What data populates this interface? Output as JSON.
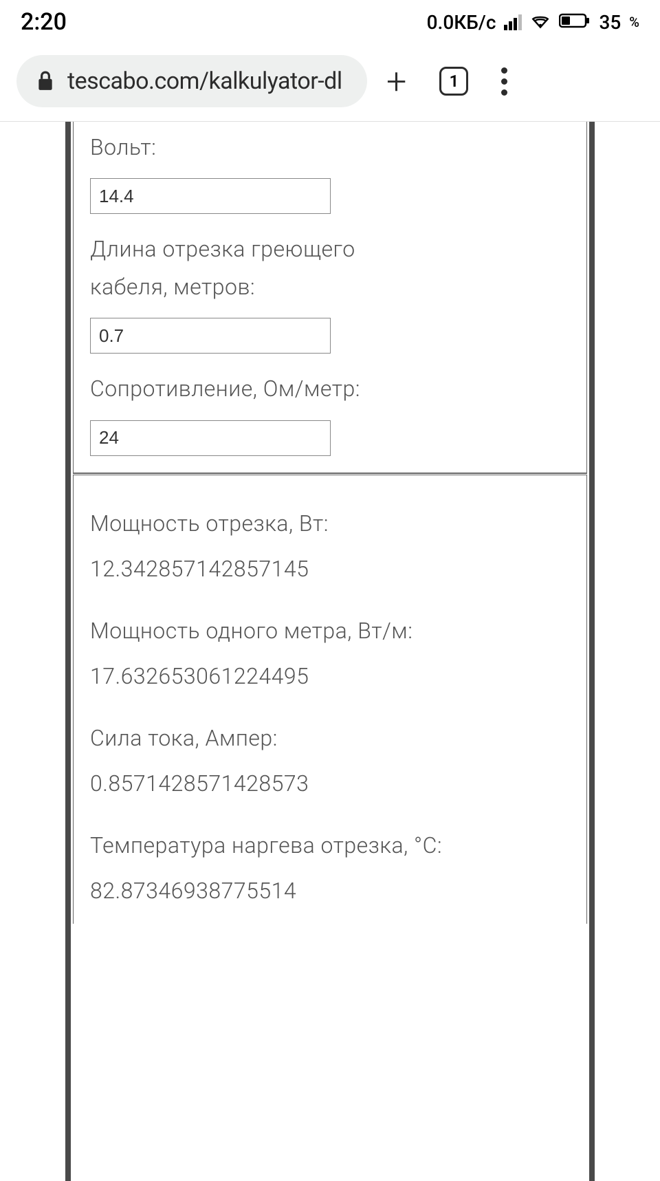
{
  "status": {
    "time": "2:20",
    "net_speed": "0.0КБ/с",
    "battery_pct": "35",
    "pct_sign": "%"
  },
  "browser": {
    "url": "tescabo.com/kalkulyator-dl",
    "tab_count": "1"
  },
  "calculator": {
    "inputs": {
      "voltage_label": "Вольт:",
      "voltage_value": "14.4",
      "length_label": "Длина отрезка греющего кабеля, метров:",
      "length_value": "0.7",
      "resistance_label": "Сопротивление, Ом/метр:",
      "resistance_value": "24"
    },
    "results": {
      "power_label": "Мощность отрезка, Вт:",
      "power_value": "12.342857142857145",
      "power_per_m_label": "Мощность одного метра, Вт/м:",
      "power_per_m_value": "17.632653061224495",
      "current_label": "Сила тока, Ампер:",
      "current_value": "0.8571428571428573",
      "temp_label": "Температура наргева отрезка, °С:",
      "temp_value": "82.87346938775514"
    }
  }
}
